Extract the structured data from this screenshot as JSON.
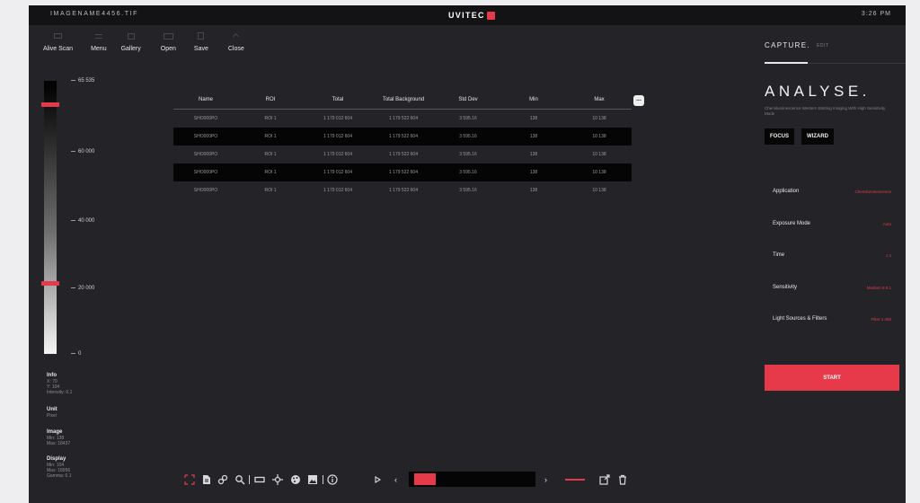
{
  "topbar": {
    "filename": "IMAGENAME4456.TIF",
    "brand": "UVITEC",
    "time": "3:26 PM",
    "accent_color": "#e63a4b"
  },
  "toolbar": {
    "items": [
      {
        "label": "Alive Scan",
        "icon": "scan-icon"
      },
      {
        "label": "Menu",
        "icon": "menu-icon"
      },
      {
        "label": "Gallery",
        "icon": "gallery-icon"
      },
      {
        "label": "Open",
        "icon": "folder-icon"
      },
      {
        "label": "Save",
        "icon": "save-icon"
      },
      {
        "label": "Close",
        "icon": "close-icon"
      }
    ]
  },
  "scale": {
    "labels": [
      "65 535",
      "60 000",
      "40 000",
      "20 000",
      "0"
    ],
    "upper_marker_value": 60000,
    "lower_marker_value": 17000
  },
  "info": {
    "groups": [
      {
        "title": "Info",
        "lines": [
          "X: 70",
          "Y: 104",
          "Intensity: 0.1"
        ]
      },
      {
        "title": "Unit",
        "lines": [
          "Pixel"
        ]
      },
      {
        "title": "Image",
        "lines": [
          "Min: 138",
          "Max: 18437"
        ]
      },
      {
        "title": "Display",
        "lines": [
          "Min: 104",
          "Max: 18956",
          "Gamma: 0.1"
        ]
      }
    ]
  },
  "table": {
    "headers": [
      "Name",
      "ROI",
      "Total",
      "Total Background",
      "Std Dev",
      "Min",
      "Max"
    ],
    "rows": [
      [
        "SHO000PO",
        "ROI 1",
        "1 179 012 604",
        "1 179 522 604",
        "3 595.16",
        "138",
        "10 138"
      ],
      [
        "SHO000PO",
        "ROI 1",
        "1 179 012 604",
        "1 179 522 604",
        "3 595.16",
        "138",
        "10 138"
      ],
      [
        "SHO000PO",
        "ROI 1",
        "1 179 012 604",
        "1 179 522 604",
        "3 595.16",
        "138",
        "10 138"
      ],
      [
        "SHO000PO",
        "ROI 1",
        "1 179 012 604",
        "1 179 522 604",
        "3 595.16",
        "138",
        "10 138"
      ],
      [
        "SHO000PO",
        "ROI 1",
        "1 179 012 604",
        "1 179 522 604",
        "3 595.16",
        "138",
        "10 138"
      ]
    ],
    "more_label": "..."
  },
  "panel": {
    "tab_capture": "CAPTURE.",
    "tab_edit": "EDIT",
    "title": "ANALYSE.",
    "description": "Chemiluminescence Western Blotting Imaging With High Sensitivity Mode",
    "mode_focus": "FOCUS",
    "mode_wizard": "WIZARD",
    "settings": [
      {
        "label": "Application",
        "value": "Chemiluminescence"
      },
      {
        "label": "Exposure Mode",
        "value": "Auto"
      },
      {
        "label": "Time",
        "value": "1 s"
      },
      {
        "label": "Sensitivity",
        "value": "Medium 8 8 1"
      },
      {
        "label": "Light Sources & Filters",
        "value": "Filter 1 350"
      }
    ],
    "start_label": "START"
  },
  "bottombar": {
    "icons": [
      "crop-icon",
      "document-icon",
      "link-icon",
      "zoom-icon",
      "rectangle-icon",
      "crosshair-icon",
      "palette-icon",
      "image-icon",
      "info-icon",
      "play-icon"
    ],
    "prev": "‹",
    "next": "›",
    "timeline_position": 0.04
  }
}
